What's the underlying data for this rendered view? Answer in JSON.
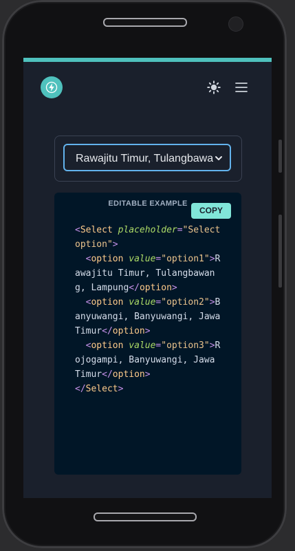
{
  "select": {
    "selected_label": "Rawajitu Timur, Tulangbawang, Lampung"
  },
  "code_panel": {
    "label": "EDITABLE EXAMPLE",
    "copy_label": "COPY",
    "code": {
      "open_tag": "Select",
      "placeholder_attr": "placeholder",
      "placeholder_value": "\"Select option\"",
      "option_tag": "option",
      "value_attr": "value",
      "options": [
        {
          "value": "\"option1\"",
          "text": "Rawajitu Timur, Tulangbawang, Lampung"
        },
        {
          "value": "\"option2\"",
          "text": "Banyuwangi, Banyuwangi, Jawa Timur"
        },
        {
          "value": "\"option3\"",
          "text": "Rojogampi, Banyuwangi, Jawa Timur"
        }
      ],
      "close_tag": "Select"
    }
  },
  "icons": {
    "logo": "lightning-bolt-icon",
    "theme": "sun-icon",
    "menu": "hamburger-menu-icon",
    "select_arrow": "chevron-down-icon"
  },
  "colors": {
    "accent": "#4fc1bd",
    "screen_bg": "#1a202c",
    "code_bg": "#011627",
    "copy_bg": "#81e6d9",
    "focus_border": "#63b3ed"
  }
}
